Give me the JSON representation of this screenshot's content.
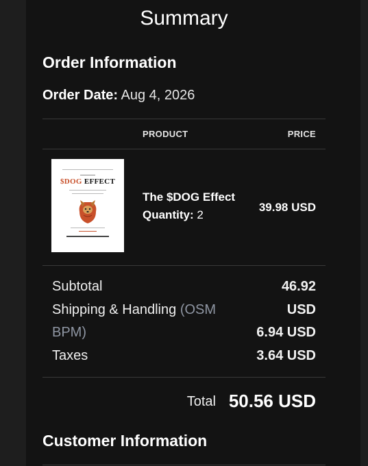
{
  "header": {
    "title": "Summary"
  },
  "order": {
    "section_title": "Order Information",
    "date_label": "Order Date:",
    "date_value": "Aug 4, 2026"
  },
  "table": {
    "col_product": "PRODUCT",
    "col_price": "PRICE"
  },
  "product": {
    "name": "The $DOG Effect",
    "quantity_label": "Quantity:",
    "quantity_value": "2",
    "price": "39.98 USD",
    "cover": {
      "title_a": "$DOG",
      "title_b": "EFFECT",
      "image": "dog-in-orange-hoodie"
    }
  },
  "totals": {
    "subtotal_label": "Subtotal",
    "shipping_label_a": "Shipping & Handling",
    "shipping_label_b": "(OSM",
    "shipping_label_c": "BPM)",
    "taxes_label": "Taxes",
    "subtotal_value_a": "46.92",
    "subtotal_value_b": "USD",
    "shipping_value": "6.94 USD",
    "taxes_value": "3.64 USD",
    "total_label": "Total",
    "total_value": "50.56 USD"
  },
  "customer": {
    "section_title": "Customer Information"
  },
  "colors": {
    "background": "#1e1e1e",
    "panel": "#131313",
    "muted_text": "#8f96a3",
    "divider": "#3a3a3a",
    "cover_orange": "#c8502a"
  }
}
